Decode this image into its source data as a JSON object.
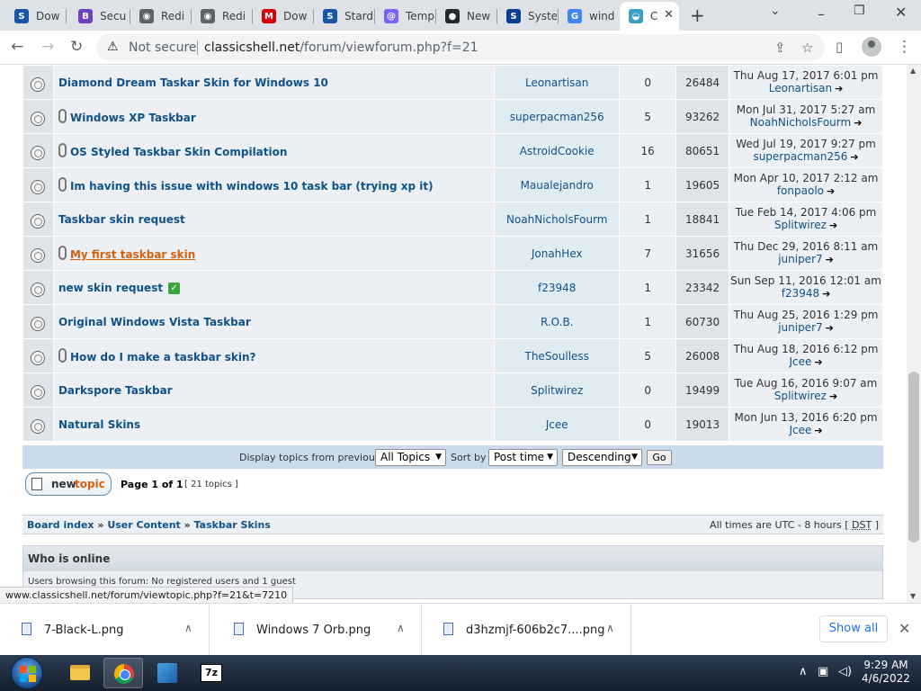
{
  "browser": {
    "tabs": [
      {
        "title": "Dow",
        "icon": "classicshell-icon",
        "color": "#1a56a7",
        "glyph": "S"
      },
      {
        "title": "Secu",
        "icon": "bootstrap-icon",
        "color": "#6f42c1",
        "glyph": "B"
      },
      {
        "title": "Redi",
        "icon": "globe-icon",
        "color": "#5f6368",
        "glyph": "◉"
      },
      {
        "title": "Redi",
        "icon": "globe-icon",
        "color": "#5f6368",
        "glyph": "◉"
      },
      {
        "title": "Dow",
        "icon": "mega-icon",
        "color": "#d90007",
        "glyph": "M"
      },
      {
        "title": "Stard",
        "icon": "classicshell-icon",
        "color": "#1a56a7",
        "glyph": "S"
      },
      {
        "title": "Temp",
        "icon": "at-icon",
        "color": "#7b61ff",
        "glyph": "@"
      },
      {
        "title": "New",
        "icon": "github-icon",
        "color": "#24292e",
        "glyph": "●"
      },
      {
        "title": "Syste",
        "icon": "s-logo-icon",
        "color": "#0b3d91",
        "glyph": "S"
      },
      {
        "title": "wind",
        "icon": "google-icon",
        "color": "#4285f4",
        "glyph": "G"
      },
      {
        "title": "C",
        "icon": "shell-icon",
        "color": "#3aa0c8",
        "glyph": "◒"
      }
    ],
    "not_secure": "Not secure",
    "url_host": "classicshell.net",
    "url_path": "/forum/viewforum.php?f=21"
  },
  "topics": [
    {
      "title": "Diamond Dream Taskar Skin for Windows 10",
      "attach": false,
      "highlight": false,
      "solved": false,
      "author": "Leonartisan",
      "replies": "0",
      "views": "26484",
      "last_time": "Thu Aug 17, 2017 6:01 pm",
      "last_user": "Leonartisan"
    },
    {
      "title": "Windows XP Taskbar",
      "attach": true,
      "highlight": false,
      "solved": false,
      "author": "superpacman256",
      "replies": "5",
      "views": "93262",
      "last_time": "Mon Jul 31, 2017 5:27 am",
      "last_user": "NoahNicholsFourm"
    },
    {
      "title": "OS Styled Taskbar Skin Compilation",
      "attach": true,
      "highlight": false,
      "solved": false,
      "author": "AstroidCookie",
      "replies": "16",
      "views": "80651",
      "last_time": "Wed Jul 19, 2017 9:27 pm",
      "last_user": "superpacman256"
    },
    {
      "title": "Im having this issue with windows 10 task bar (trying xp it)",
      "attach": true,
      "highlight": false,
      "solved": false,
      "author": "Maualejandro",
      "replies": "1",
      "views": "19605",
      "last_time": "Mon Apr 10, 2017 2:12 am",
      "last_user": "fonpaolo"
    },
    {
      "title": "Taskbar skin request",
      "attach": false,
      "highlight": false,
      "solved": false,
      "author": "NoahNicholsFourm",
      "replies": "1",
      "views": "18841",
      "last_time": "Tue Feb 14, 2017 4:06 pm",
      "last_user": "Splitwirez"
    },
    {
      "title": "My first taskbar skin",
      "attach": true,
      "highlight": true,
      "solved": false,
      "author": "JonahHex",
      "replies": "7",
      "views": "31656",
      "last_time": "Thu Dec 29, 2016 8:11 am",
      "last_user": "juniper7"
    },
    {
      "title": "new skin request",
      "attach": false,
      "highlight": false,
      "solved": true,
      "author": "f23948",
      "replies": "1",
      "views": "23342",
      "last_time": "Sun Sep 11, 2016 12:01 am",
      "last_user": "f23948"
    },
    {
      "title": "Original Windows Vista Taskbar",
      "attach": false,
      "highlight": false,
      "solved": false,
      "author": "R.O.B.",
      "replies": "1",
      "views": "60730",
      "last_time": "Thu Aug 25, 2016 1:29 pm",
      "last_user": "juniper7"
    },
    {
      "title": "How do I make a taskbar skin?",
      "attach": true,
      "highlight": false,
      "solved": false,
      "author": "TheSoulless",
      "replies": "5",
      "views": "26008",
      "last_time": "Thu Aug 18, 2016 6:12 pm",
      "last_user": "Jcee"
    },
    {
      "title": "Darkspore Taskbar",
      "attach": false,
      "highlight": false,
      "solved": false,
      "author": "Splitwirez",
      "replies": "0",
      "views": "19499",
      "last_time": "Tue Aug 16, 2016 9:07 am",
      "last_user": "Splitwirez"
    },
    {
      "title": "Natural Skins",
      "attach": false,
      "highlight": false,
      "solved": false,
      "author": "Jcee",
      "replies": "0",
      "views": "19013",
      "last_time": "Mon Jun 13, 2016 6:20 pm",
      "last_user": "Jcee"
    }
  ],
  "display": {
    "from_label": "Display topics from previous:",
    "from_value": "All Topics",
    "sort_label": "Sort by",
    "sort_value": "Post time",
    "order_value": "Descending",
    "go_label": "Go"
  },
  "pagination": {
    "new_label_1": "new",
    "new_label_2": "topic",
    "page_info": "Page 1 of 1",
    "topic_count": "[ 21 topics ]"
  },
  "breadcrumb": {
    "board_index": "Board index",
    "separator": "»",
    "user_content": "User Content",
    "taskbar_skins": "Taskbar Skins",
    "tz_text": "All times are UTC - 8 hours [",
    "dst": "DST",
    "tz_close": "]"
  },
  "online": {
    "heading": "Who is online",
    "body": "Users browsing this forum: No registered users and 1 guest"
  },
  "status_url": "www.classicshell.net/forum/viewtopic.php?f=21&t=7210",
  "downloads": [
    {
      "name": "7-Black-L.png"
    },
    {
      "name": "Windows 7 Orb.png"
    },
    {
      "name": "d3hzmjf-606b2c7....png"
    }
  ],
  "show_all": "Show all",
  "taskbar": {
    "sevenzip": "7z",
    "time": "9:29 AM",
    "date": "4/6/2022"
  }
}
